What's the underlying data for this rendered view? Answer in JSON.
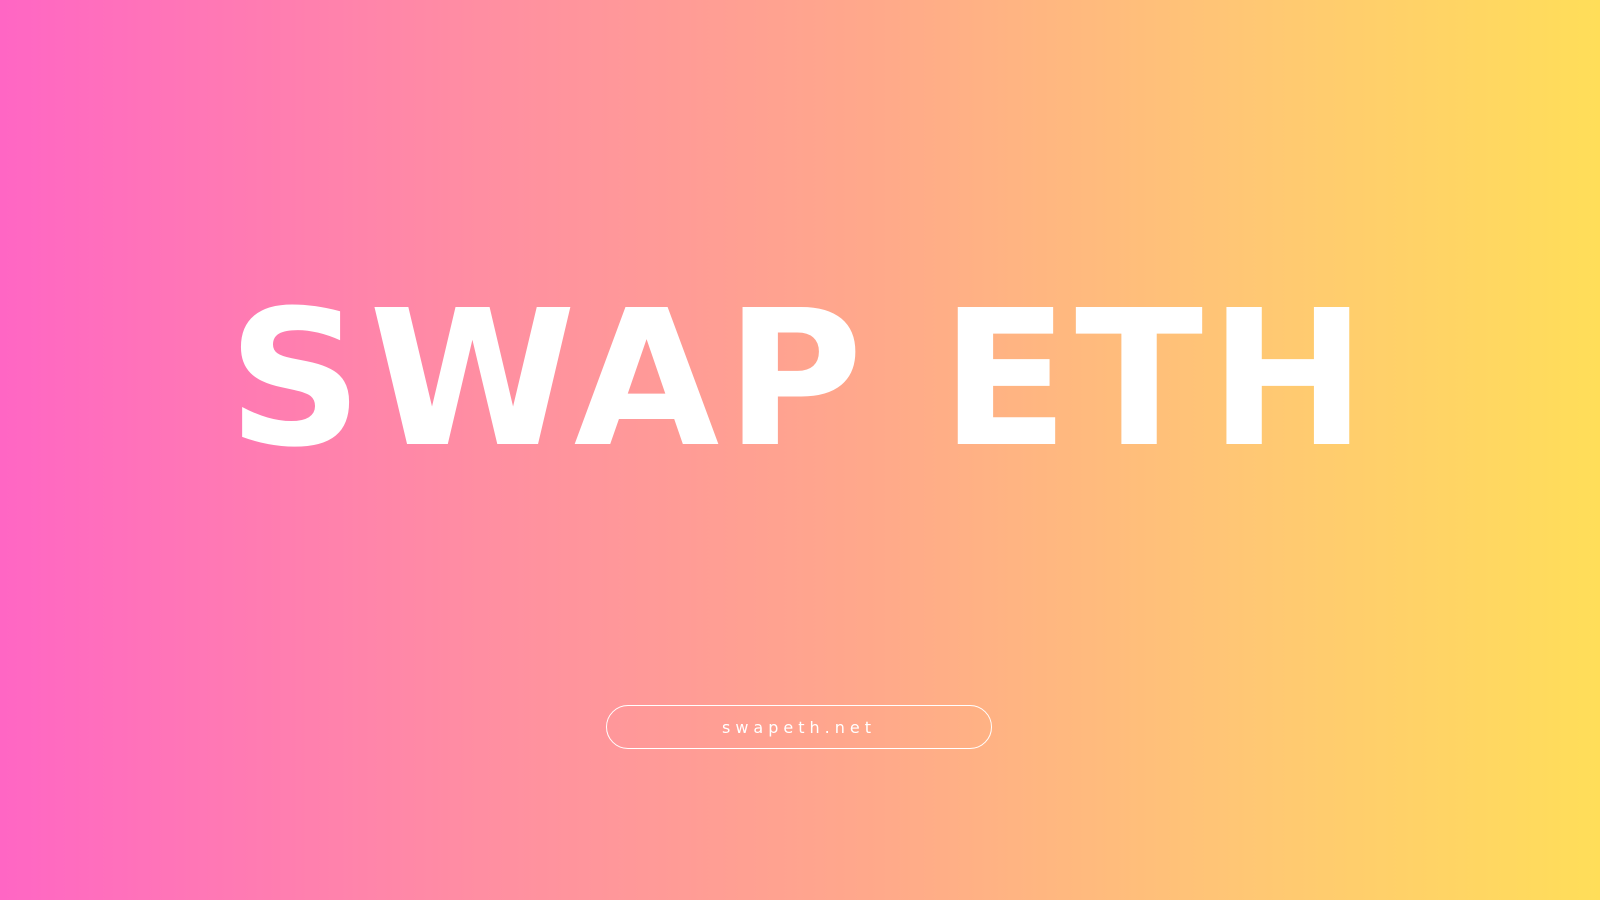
{
  "banner": {
    "headline": "SWAP ETH",
    "link_text": "swapeth.net",
    "gradient_colors": [
      "#ff66c4",
      "#ff8ea2",
      "#ffa98a",
      "#ffc774",
      "#ffde59"
    ],
    "text_color": "#ffffff"
  }
}
